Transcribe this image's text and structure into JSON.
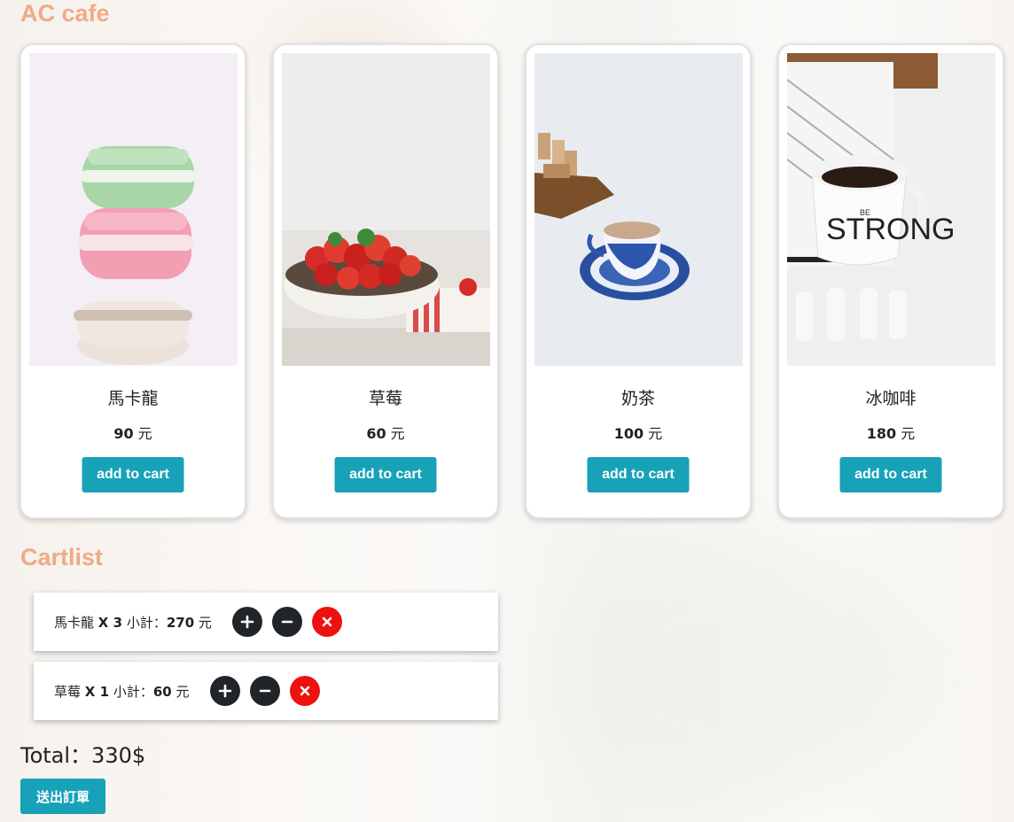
{
  "site": {
    "title": "AC cafe"
  },
  "products": [
    {
      "name": "馬卡龍",
      "price": "90",
      "unit": "元",
      "button": "add to cart",
      "image": "macarons-photo"
    },
    {
      "name": "草莓",
      "price": "60",
      "unit": "元",
      "button": "add to cart",
      "image": "strawberries-photo"
    },
    {
      "name": "奶茶",
      "price": "100",
      "unit": "元",
      "button": "add to cart",
      "image": "milk-tea-photo"
    },
    {
      "name": "冰咖啡",
      "price": "180",
      "unit": "元",
      "button": "add to cart",
      "image": "coffee-mug-photo"
    }
  ],
  "cart": {
    "title": "Cartlist",
    "items": [
      {
        "name": "馬卡龍",
        "qty": "X 3",
        "subtotal_label": "小計：",
        "subtotal": "270",
        "unit": "元"
      },
      {
        "name": "草莓",
        "qty": "X 1",
        "subtotal_label": "小計：",
        "subtotal": "60",
        "unit": "元"
      }
    ],
    "total": "Total：330$",
    "submit": "送出訂單"
  },
  "colors": {
    "accent": "#eeab86",
    "primary_button": "#17a2b8",
    "dark_button": "#212529",
    "remove_button": "#ee1111"
  },
  "icons": {
    "increase": "plus-icon",
    "decrease": "minus-icon",
    "remove": "close-icon"
  }
}
